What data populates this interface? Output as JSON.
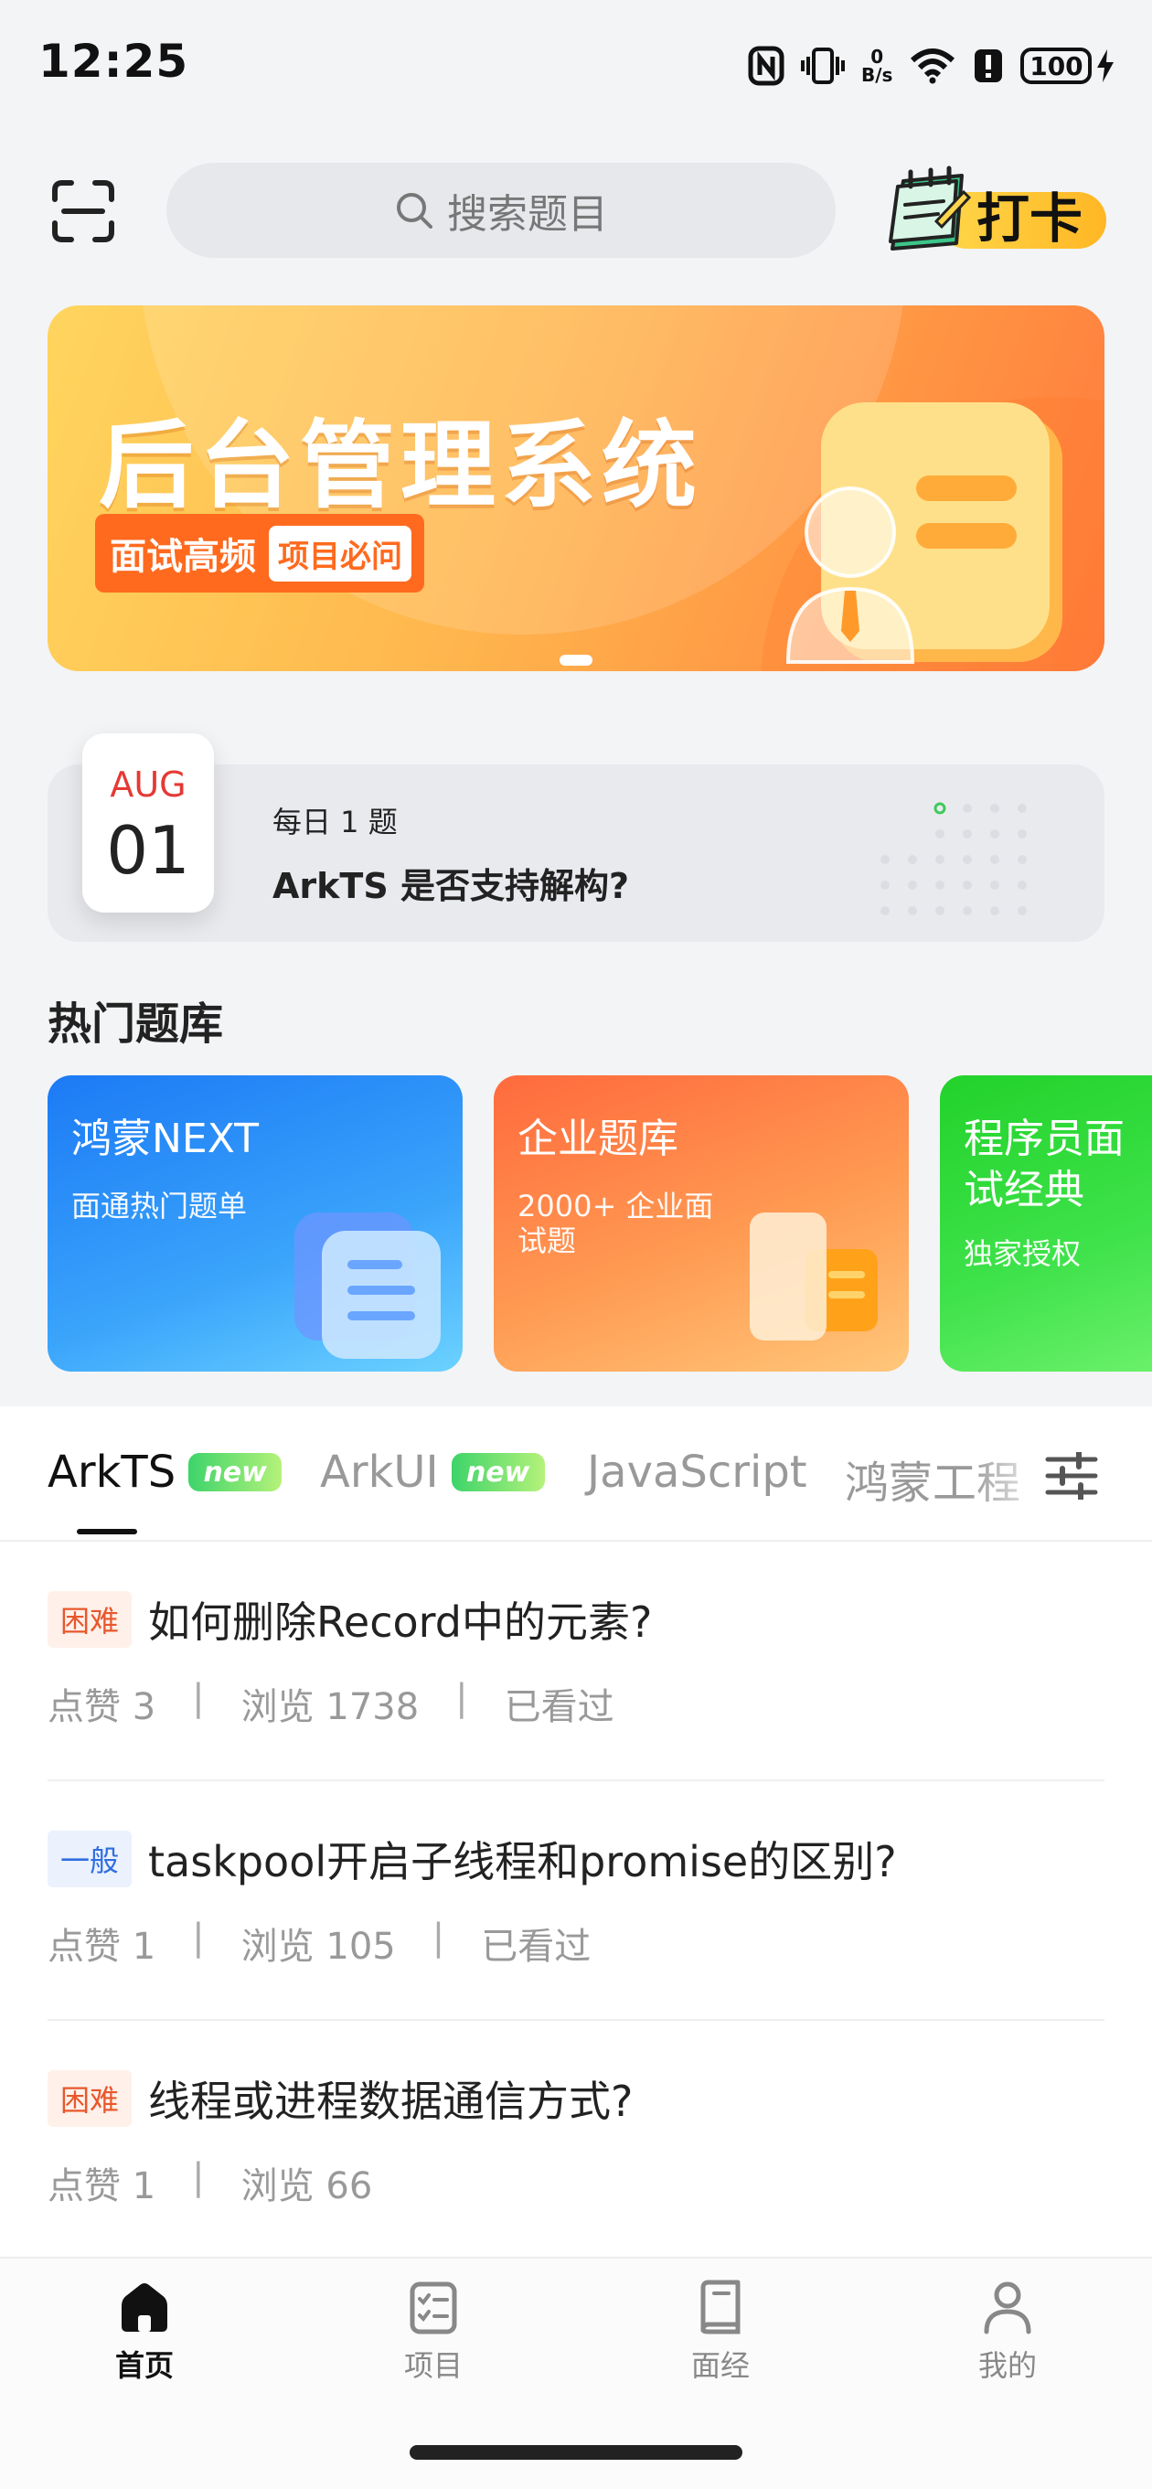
{
  "status_bar": {
    "time": "12:25",
    "net_speed_value": "0",
    "net_speed_unit": "B/s",
    "battery": "100",
    "icons": [
      "nfc-icon",
      "vibrate-icon",
      "wifi-icon",
      "alert-icon",
      "battery-icon",
      "charging-icon"
    ]
  },
  "header": {
    "search_placeholder": "搜索题目",
    "checkin_label": "打卡"
  },
  "banner": {
    "title": "后台管理系统",
    "tag_main": "面试高频",
    "tag_sub": "项目必问",
    "page_index": 1
  },
  "daily": {
    "month": "AUG",
    "day": "01",
    "label": "每日 1 题",
    "question": "ArkTS 是否支持解构?"
  },
  "hot_bank": {
    "title": "热门题库",
    "cards": [
      {
        "title": "鸿蒙NEXT",
        "subtitle": "面通热门题单"
      },
      {
        "title": "企业题库",
        "subtitle_line1": "2000+ 企业面",
        "subtitle_line2": "试题"
      },
      {
        "title_line1": "程序员面",
        "title_line2": "试经典",
        "subtitle": "独家授权"
      }
    ]
  },
  "tabs": [
    {
      "label": "ArkTS",
      "badge": "new",
      "active": true
    },
    {
      "label": "ArkUI",
      "badge": "new",
      "active": false
    },
    {
      "label": "JavaScript",
      "active": false
    },
    {
      "label": "鸿蒙工程",
      "active": false
    }
  ],
  "questions": [
    {
      "difficulty": "困难",
      "title": "如何删除Record中的元素?",
      "likes": "点赞 3",
      "views": "浏览 1738",
      "seen": "已看过"
    },
    {
      "difficulty": "一般",
      "title": "taskpool开启子线程和promise的区别?",
      "likes": "点赞 1",
      "views": "浏览 105",
      "seen": "已看过"
    },
    {
      "difficulty": "困难",
      "title": "线程或进程数据通信方式?",
      "likes": "点赞 1",
      "views": "浏览 66"
    }
  ],
  "separator": "|",
  "bottom_nav": [
    {
      "label": "首页",
      "icon": "home-icon",
      "active": true
    },
    {
      "label": "项目",
      "icon": "checklist-icon",
      "active": false
    },
    {
      "label": "面经",
      "icon": "book-icon",
      "active": false
    },
    {
      "label": "我的",
      "icon": "person-icon",
      "active": false
    }
  ],
  "colors": {
    "hard": "#e8572b",
    "normal": "#2f6ee0",
    "checkin_yellow": "#ffc83a",
    "banner_orange": "#ff7a3c"
  }
}
